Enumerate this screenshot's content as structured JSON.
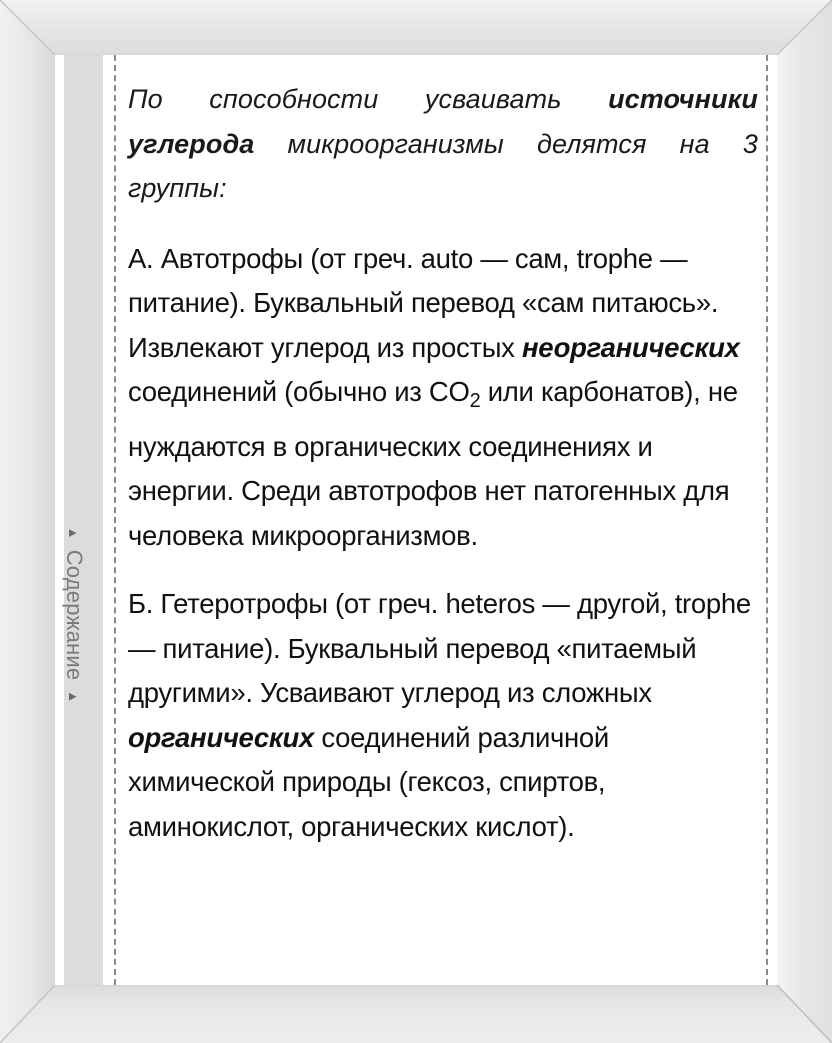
{
  "sidebar": {
    "label": "Содержание",
    "arrow_start": "▲",
    "arrow_end": "▲",
    "arrow_icon": "triangle-up-icon"
  },
  "intro": {
    "part1": "По способности усваивать ",
    "bold": "источники углерода",
    "part2": " микроорганизмы делятся на 3 группы:"
  },
  "autotrophs": {
    "part1": "А. Автотрофы (от греч. auto — сам, trophe — питание). Буквальный перевод «сам питаюсь». Извлекают углерод из простых ",
    "bold": "неорганических",
    "part2": " соединений (обычно из CO",
    "subscript": "2",
    "part3": " или карбонатов), не",
    "part4": "нуждаются в органических соединениях и энергии. Среди автотрофов нет патогенных для человека микроорганизмов."
  },
  "heterotrophs": {
    "part1": "Б. Гетеротрофы (от греч. heteros — другой, trophe — питание). Буквальный перевод «питаемый другими». Усваивают углерод из сложных ",
    "bold": "органических",
    "part2": " соединений различной химической природы (гексоз, спиртов, аминокислот, органических кислот)."
  }
}
